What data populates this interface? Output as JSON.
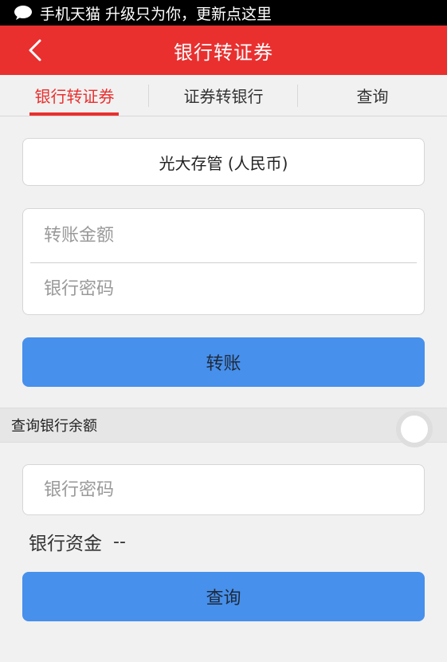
{
  "statusbar": {
    "notification": "手机天猫 升级只为你，更新点这里"
  },
  "header": {
    "title": "银行转证券"
  },
  "tabs": [
    {
      "label": "银行转证券"
    },
    {
      "label": "证券转银行"
    },
    {
      "label": "查询"
    }
  ],
  "transfer": {
    "account_selector": "光大存管 (人民币)",
    "amount_placeholder": "转账金额",
    "password_placeholder": "银行密码",
    "submit_label": "转账"
  },
  "balance_section": {
    "title": "查询银行余额",
    "password_placeholder": "银行密码",
    "funds_label": "银行资金",
    "funds_value": "--",
    "query_label": "查询"
  },
  "colors": {
    "accent": "#e9302f",
    "button": "#4790ec"
  }
}
